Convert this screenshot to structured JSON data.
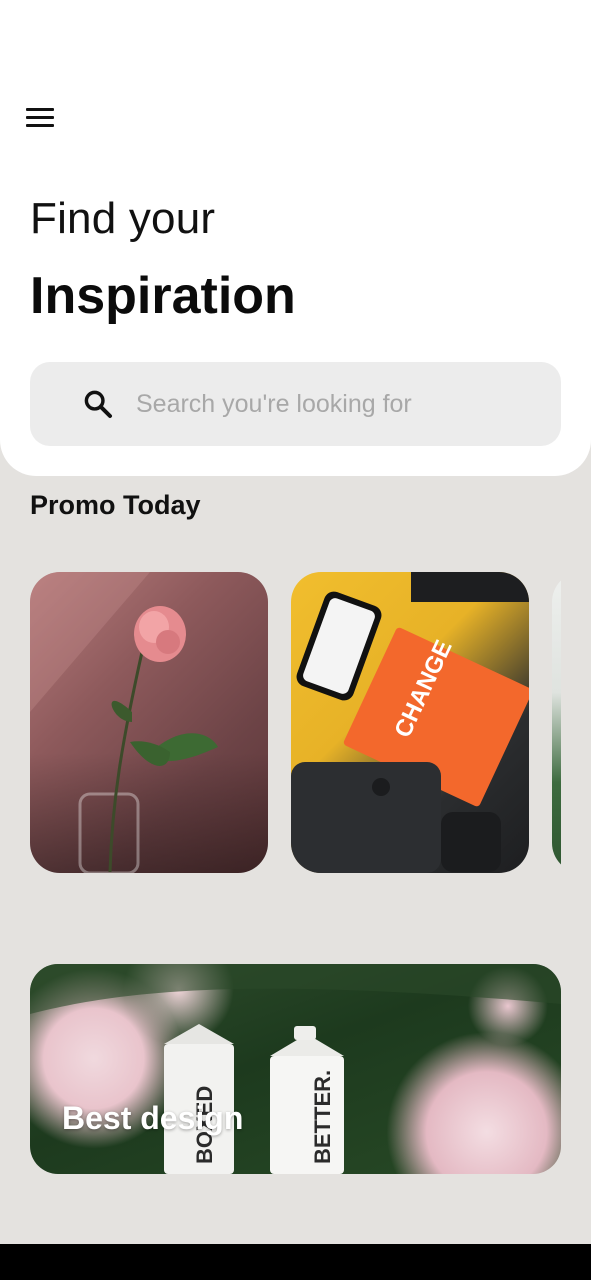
{
  "header": {
    "title_light": "Find your",
    "title_bold": "Inspiration"
  },
  "search": {
    "placeholder": "Search you're looking for",
    "value": ""
  },
  "promo": {
    "section_title": "Promo Today",
    "cards": [
      {
        "image": "pink-rose-in-vase"
      },
      {
        "image": "change-by-design-book-desk"
      },
      {
        "image": "green-plant"
      }
    ]
  },
  "featured": {
    "label": "Best design",
    "image": "boxed-water-cartons-with-peonies"
  },
  "colors": {
    "page_background": "#e4e2df",
    "header_background": "#ffffff",
    "search_background": "#ececec",
    "text": "#111111",
    "placeholder": "#a8a8a8"
  }
}
